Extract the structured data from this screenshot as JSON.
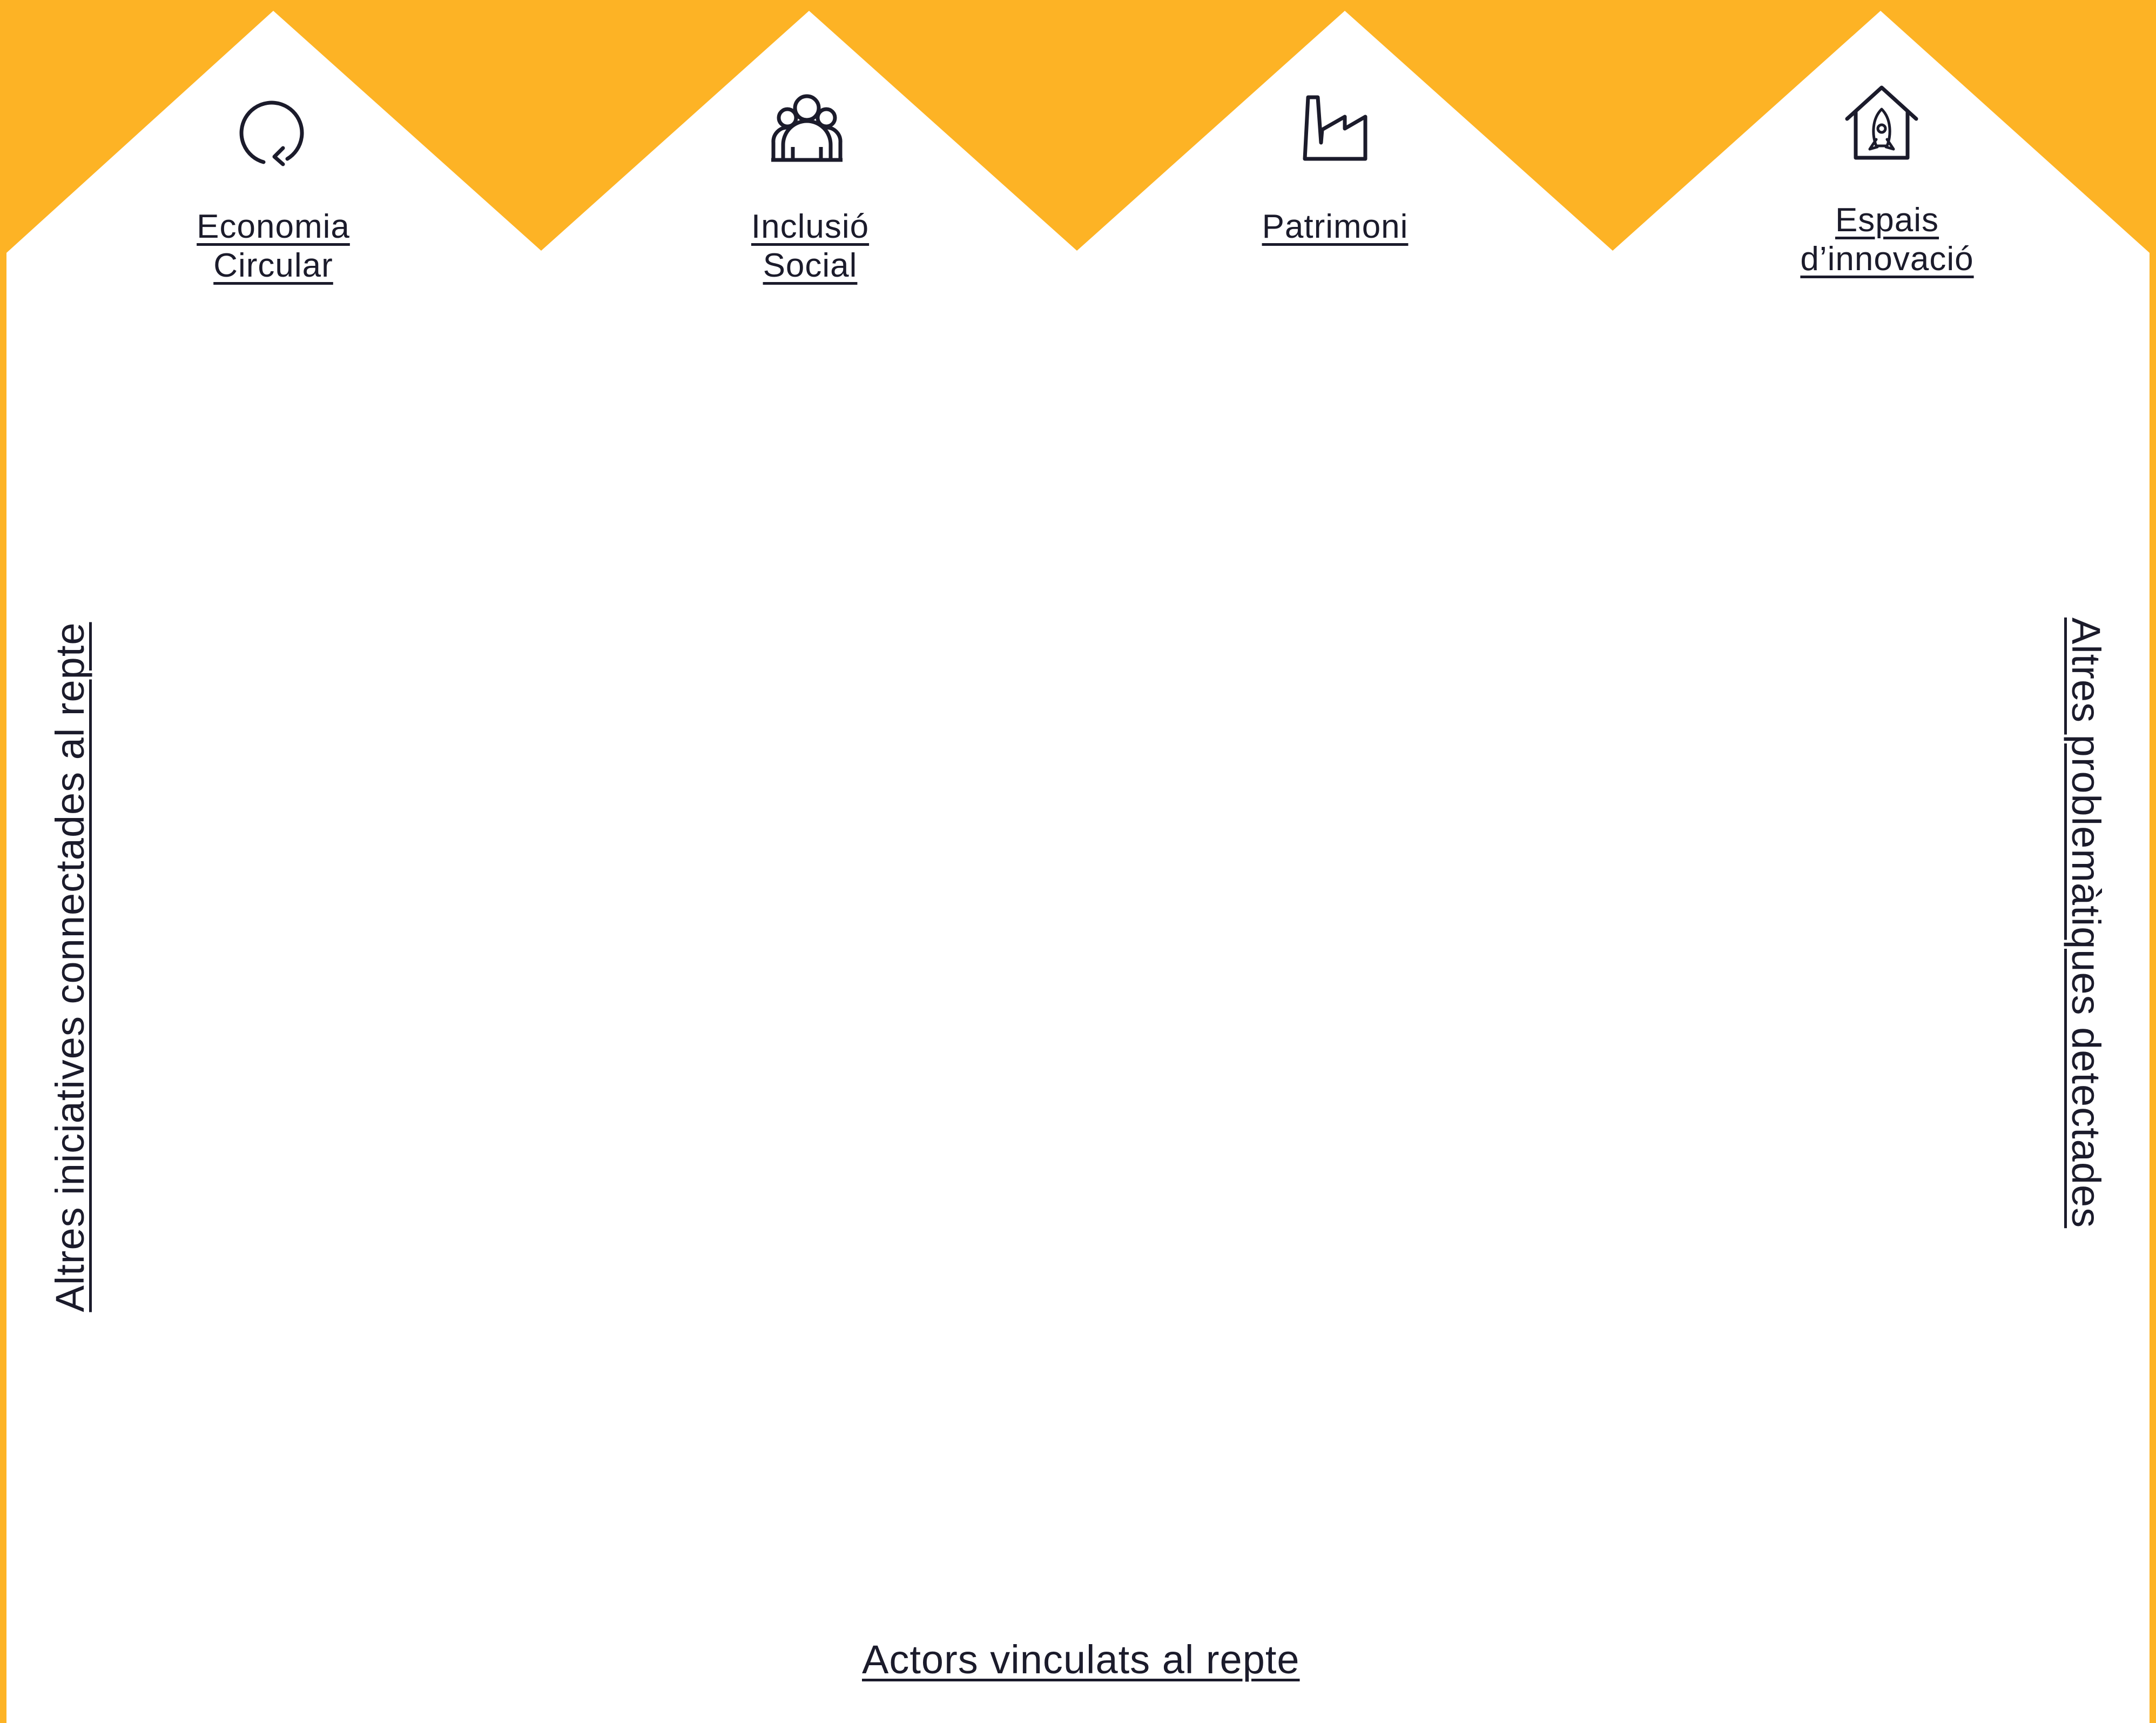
{
  "colors": {
    "accent": "#FDB325",
    "text": "#1B1B2B",
    "background": "#FFFFFF"
  },
  "categories": [
    {
      "label_line1": "Economia",
      "label_line2": "Circular",
      "icon": "circular-arrow-icon"
    },
    {
      "label_line1": "Inclusió",
      "label_line2": "Social",
      "icon": "people-group-icon"
    },
    {
      "label_line1": "Patrimoni",
      "label_line2": "",
      "icon": "factory-icon"
    },
    {
      "label_line1": "Espais ",
      "label_line2": "d’innovació",
      "icon": "rocket-house-icon"
    }
  ],
  "side_labels": {
    "left": "Altres iniciatives connectades al repte",
    "right": "Altres problemàtiques detectades"
  },
  "bottom_label": "Actors vinculats al repte"
}
